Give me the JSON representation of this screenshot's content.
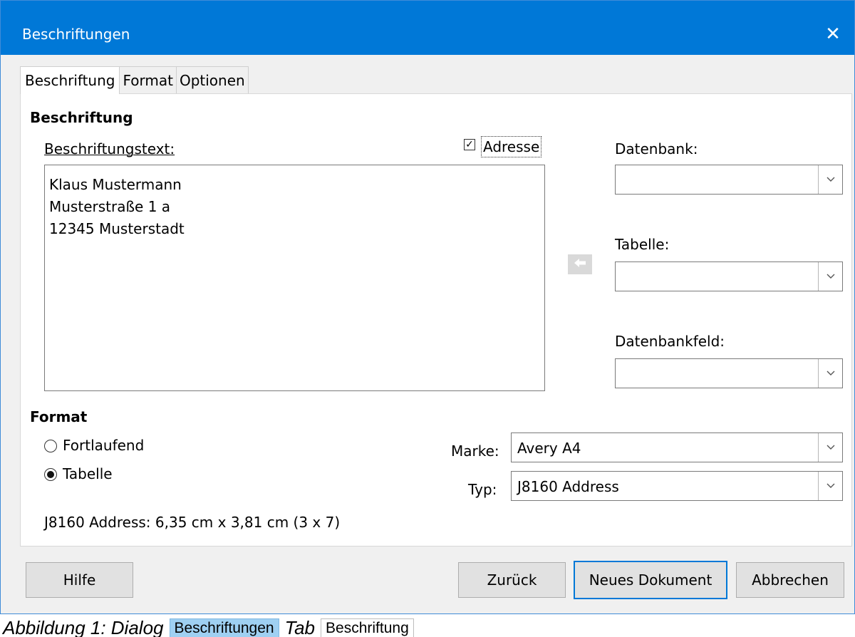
{
  "window": {
    "title": "Beschriftungen",
    "close_glyph": "✕"
  },
  "tabs": [
    {
      "label": "Beschriftung",
      "active": true
    },
    {
      "label": "Format",
      "active": false
    },
    {
      "label": "Optionen",
      "active": false
    }
  ],
  "inscription": {
    "heading": "Beschriftung",
    "text_label": "Beschriftungstext:",
    "text_value": "Klaus Mustermann\nMusterstraße 1 a\n12345 Musterstadt",
    "address_label": "Adresse",
    "address_checked": true
  },
  "database": {
    "datenbank_label": "Datenbank:",
    "datenbank_value": "",
    "tabelle_label": "Tabelle:",
    "tabelle_value": "",
    "feld_label": "Datenbankfeld:",
    "feld_value": "",
    "insert_icon": "arrow-left-icon"
  },
  "format": {
    "heading": "Format",
    "fortlaufend_label": "Fortlaufend",
    "tabelle_label": "Tabelle",
    "selected": "Tabelle",
    "marke_label": "Marke:",
    "marke_value": "Avery A4",
    "typ_label": "Typ:",
    "typ_value": "J8160 Address",
    "info": "J8160 Address: 6,35 cm x 3,81 cm (3 x 7)"
  },
  "buttons": {
    "help": "Hilfe",
    "back": "Zurück",
    "new_document": "Neues Dokument",
    "cancel": "Abbrechen"
  },
  "caption": {
    "prefix": "Abbildung 1: Dialog",
    "dialog_chip": "Beschriftungen",
    "middle": "Tab",
    "tab_chip": "Beschriftung"
  },
  "colors": {
    "titlebar": "#0078d7",
    "accent": "#0078d7",
    "chip_highlight": "#9fd0f2"
  }
}
